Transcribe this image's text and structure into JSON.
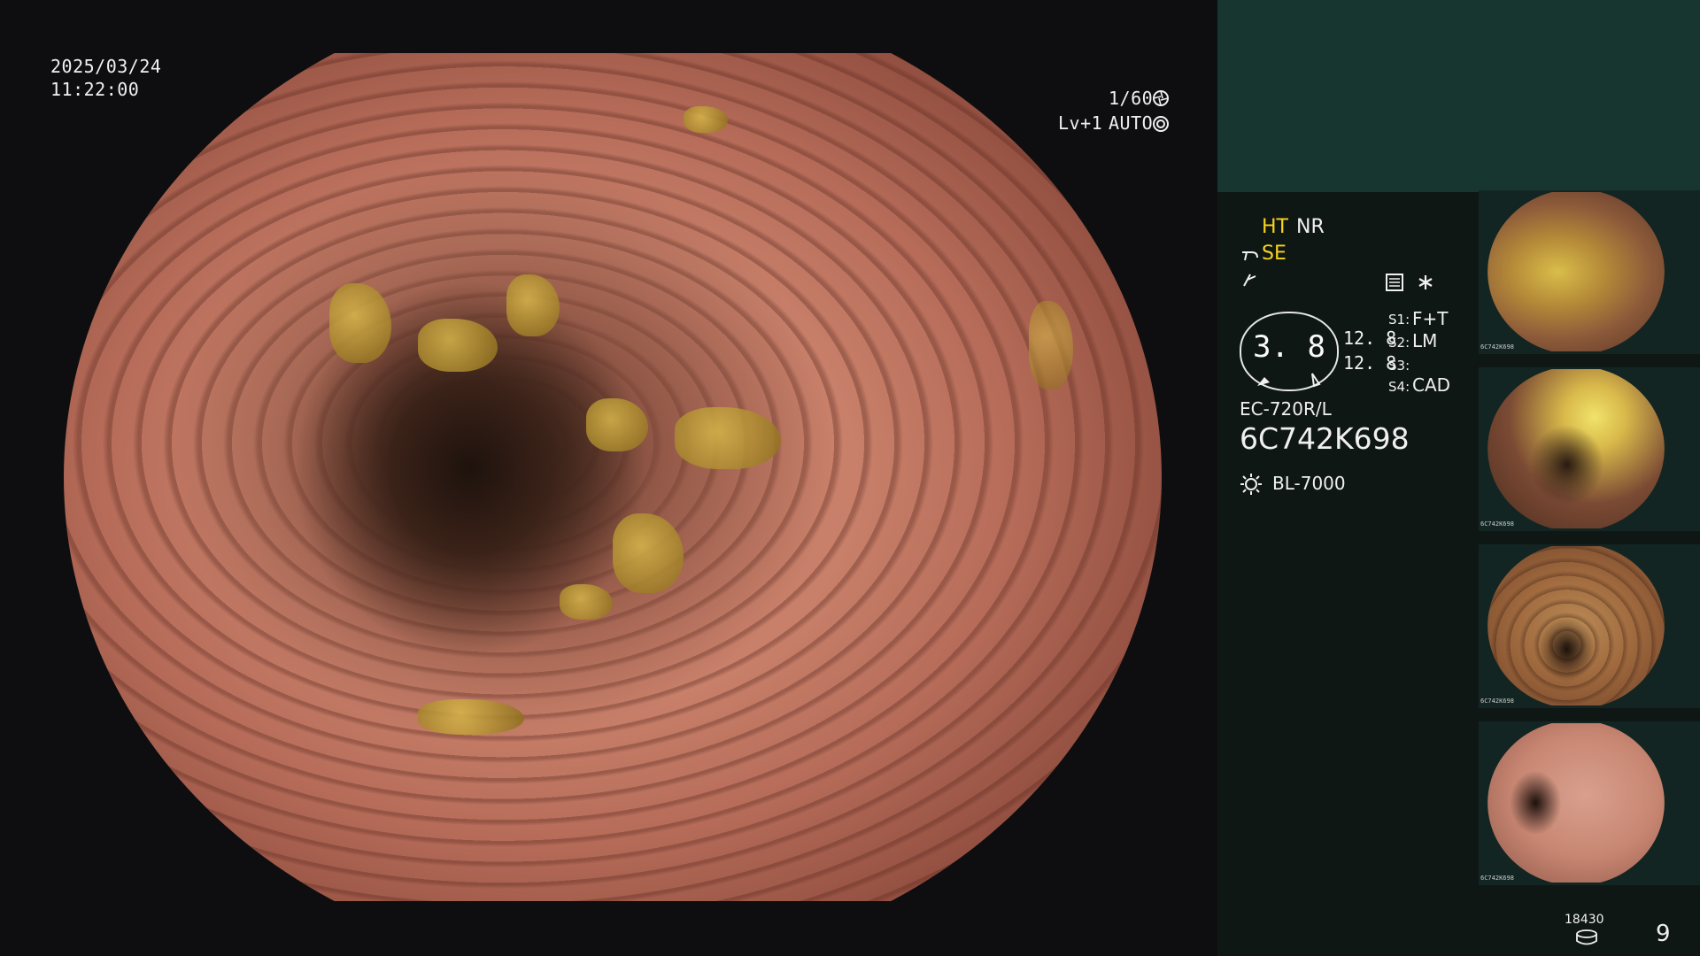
{
  "overlay": {
    "date": "2025/03/24",
    "time": "11:22:00",
    "shutter": "1/60",
    "level": "Lv+1",
    "mode": "AUTO"
  },
  "settings": {
    "ht": "HT",
    "nr": "NR",
    "se": "SE",
    "gauge_value": "3. 8",
    "value_1": "12. 8",
    "value_2": "12. 8",
    "s1_label": "S1:",
    "s1_value": "F+T",
    "s2_label": "S2:",
    "s2_value": "LM",
    "s3_label": "S3:",
    "s3_value": "",
    "s4_label": "S4:",
    "s4_value": "CAD",
    "scope_model": "EC-720R/L",
    "serial": "6C742K698",
    "light_source": "BL-7000"
  },
  "footer": {
    "count": "18430",
    "page": "9"
  },
  "thumbnails": [
    {
      "label": "6C742K698"
    },
    {
      "label": "6C742K698"
    },
    {
      "label": "6C742K698"
    },
    {
      "label": "6C742K698"
    }
  ],
  "colors": {
    "accent_yellow": "#f7d31e",
    "panel_top": "#173630",
    "panel_bg": "#0f1715"
  },
  "icons": [
    "shutter-icon",
    "auto-iris-icon",
    "scope-tip-icon",
    "zoom-icon",
    "menu-icon",
    "star-icon",
    "light-source-icon",
    "disk-icon"
  ]
}
